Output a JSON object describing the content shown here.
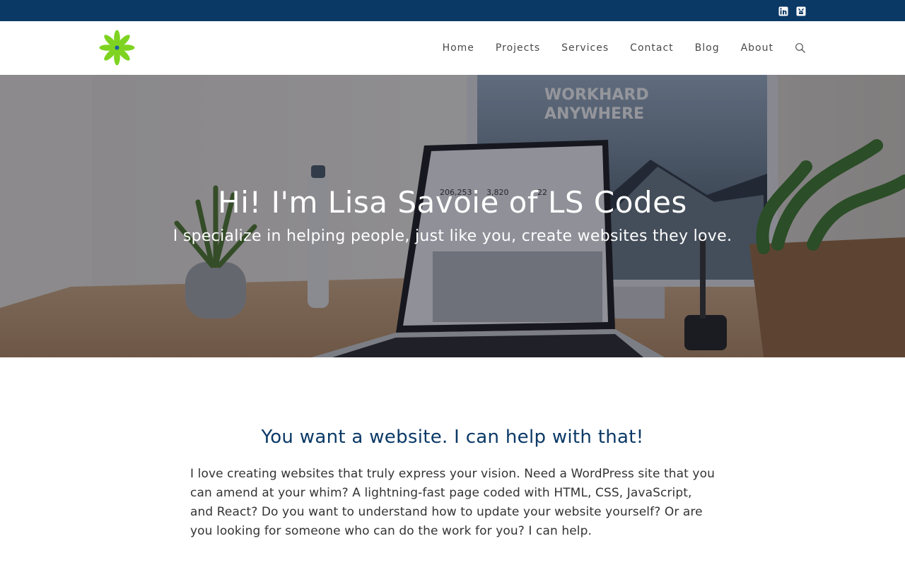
{
  "topbar": {
    "social": [
      {
        "icon": "linkedin-icon"
      },
      {
        "icon": "github-icon"
      }
    ],
    "bg_color": "#0b3966"
  },
  "header": {
    "logo_icon": "flower-logo-icon",
    "nav": [
      {
        "label": "Home"
      },
      {
        "label": "Projects"
      },
      {
        "label": "Services"
      },
      {
        "label": "Contact"
      },
      {
        "label": "Blog"
      },
      {
        "label": "About"
      }
    ],
    "search_icon": "search-icon"
  },
  "hero": {
    "title": "Hi! I'm Lisa Savoie of LS Codes",
    "subtitle": "I specialize in helping people, just like you, create websites they love.",
    "monitor_text_1": "WORKHARD",
    "monitor_text_2": "ANYWHERE",
    "screen_stats": [
      "206,253",
      "3,820",
      "22"
    ]
  },
  "intro": {
    "heading": "You want a website. I can help with that!",
    "body": "I love creating websites that truly express your vision. Need a WordPress site that you can amend at your whim? A lightning-fast page coded with HTML, CSS, JavaScript, and React? Do you want to understand how to update your website yourself? Or are you looking for someone who can do the work for you? I can help."
  },
  "colors": {
    "accent": "#0b3966",
    "logo_green": "#7ed321",
    "logo_center": "#1a5fa0"
  }
}
